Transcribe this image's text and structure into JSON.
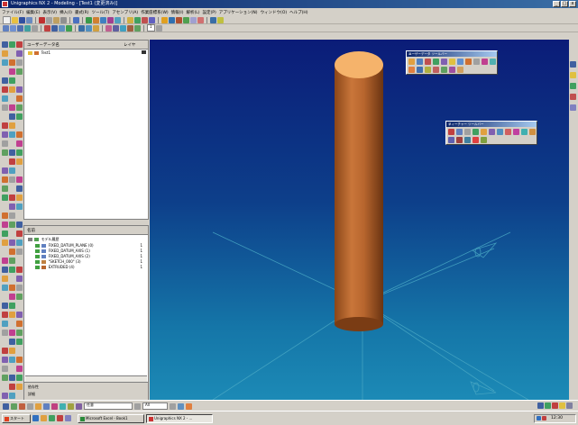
{
  "window": {
    "title": "Unigraphics NX 2 - Modeling - [Test1 (変更済み)]",
    "minimize": "_",
    "maximize": "□",
    "close": "x"
  },
  "menu": [
    "ファイル(F)",
    "編集(E)",
    "表示(V)",
    "挿入(I)",
    "書式(R)",
    "ツール(T)",
    "アセンブリ(A)",
    "作業座標系(W)",
    "情報(I)",
    "解析(L)",
    "設定(P)",
    "アプリケーション(N)",
    "ウィンドウ(O)",
    "ヘルプ(H)"
  ],
  "toolbar": {
    "layer_select": "1"
  },
  "user_navigator": {
    "title": "ユーザーデータ名",
    "col_layer": "レイヤ",
    "root_item": "Test1"
  },
  "model_navigator": {
    "col_name": "名前",
    "root": "モデル履歴",
    "items": [
      {
        "label": "FIXED_DATUM_PLANE (0)",
        "count": "1"
      },
      {
        "label": "FIXED_DATUM_AXIS (1)",
        "count": "1"
      },
      {
        "label": "FIXED_DATUM_AXIS (2)",
        "count": "1"
      },
      {
        "label": "\"SKETCH_000\" (3)",
        "count": "1"
      },
      {
        "label": "EXTRUDED (4)",
        "count": "1"
      }
    ],
    "footer1": "依存性",
    "footer2": "詳細"
  },
  "float_toolbar_1": {
    "title": "ユーザーデータ ツールバー"
  },
  "float_toolbar_2": {
    "title": "フィーチャー ツールバー"
  },
  "statusbar": {
    "filter": "任意",
    "filter2": "All"
  },
  "taskbar": {
    "start": "スタート",
    "tasks": [
      "Microsoft Excel - Book1",
      "Unigraphics NX 2 - ..."
    ],
    "clock": "12:30"
  },
  "colors": {
    "cylinder_body": "#b8662e",
    "cylinder_top": "#f5b36b",
    "viewport_top": "#0b1c78",
    "viewport_bottom": "#1c8ab6"
  }
}
